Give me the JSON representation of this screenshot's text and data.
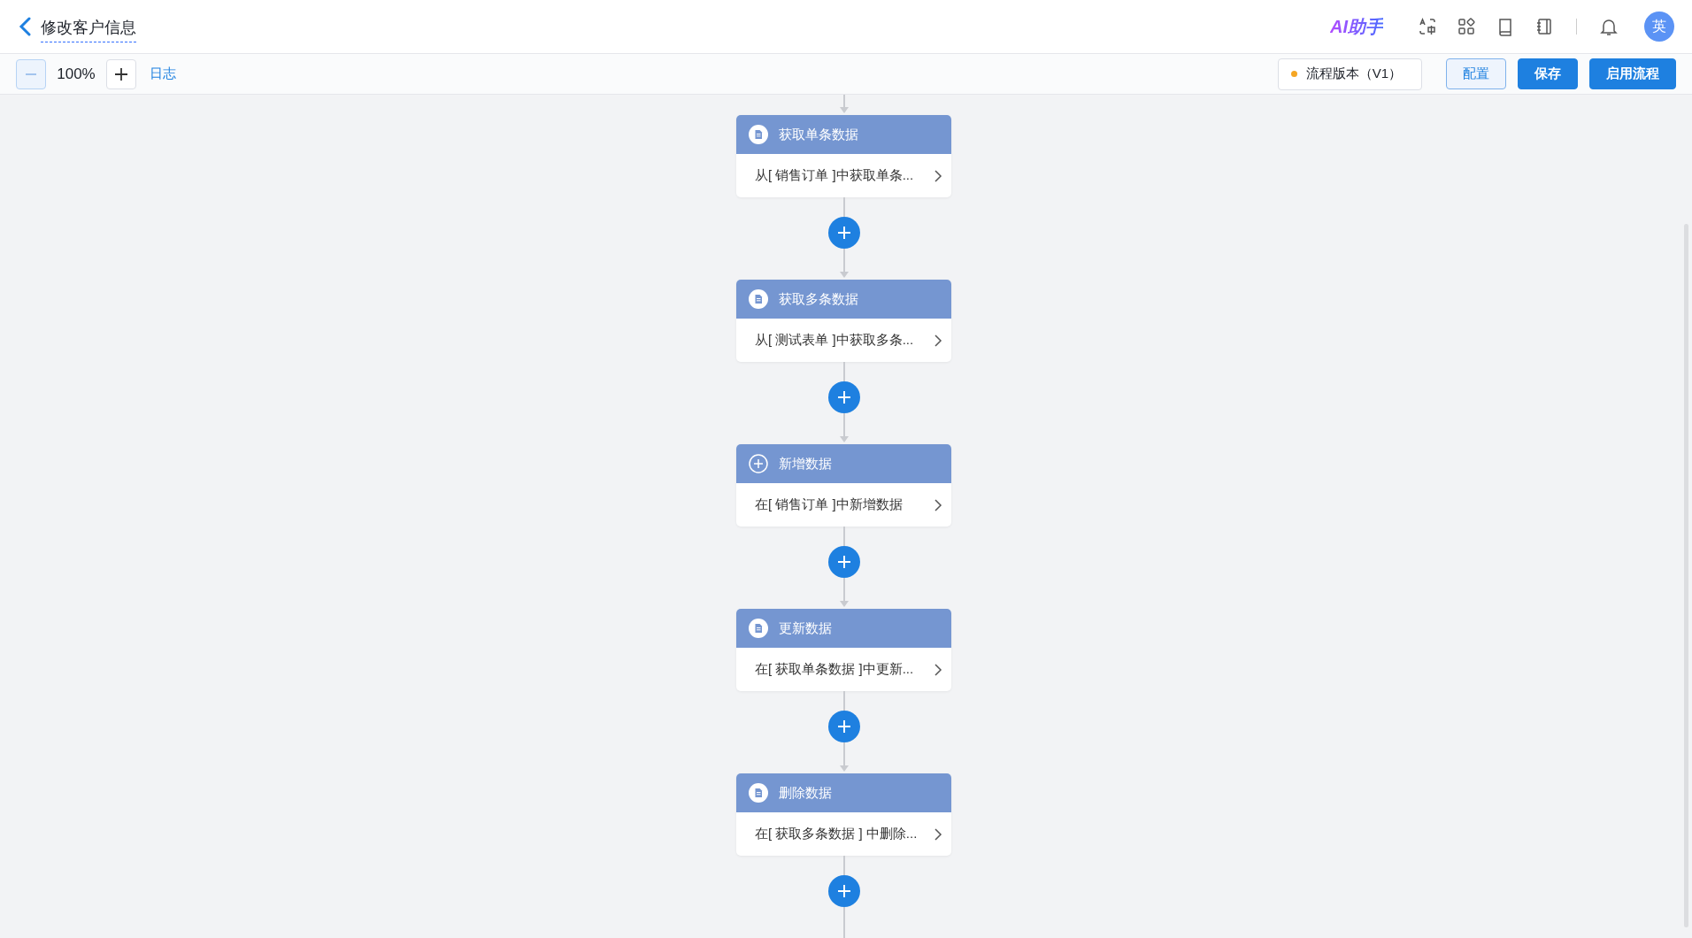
{
  "header": {
    "title": "修改客户信息",
    "ai_label": "AI助手",
    "avatar": "英"
  },
  "toolbar": {
    "zoom": "100%",
    "log_link": "日志",
    "version": "流程版本（V1）",
    "buttons": [
      {
        "label": "配置",
        "kind": "secondary"
      },
      {
        "label": "保存",
        "kind": "primary"
      },
      {
        "label": "启用流程",
        "kind": "primary"
      }
    ]
  },
  "nodes": [
    {
      "title": "获取单条数据",
      "kind": "document",
      "summary": "从[ 销售订单 ]中获取单条..."
    },
    {
      "title": "获取多条数据",
      "kind": "document",
      "summary": "从[ 测试表单 ]中获取多条..."
    },
    {
      "title": "新增数据",
      "kind": "add",
      "summary": "在[ 销售订单 ]中新增数据"
    },
    {
      "title": "更新数据",
      "kind": "document",
      "summary": "在[ 获取单条数据 ]中更新..."
    },
    {
      "title": "删除数据",
      "kind": "document",
      "summary": "在[ 获取多条数据 ] 中删除..."
    }
  ]
}
